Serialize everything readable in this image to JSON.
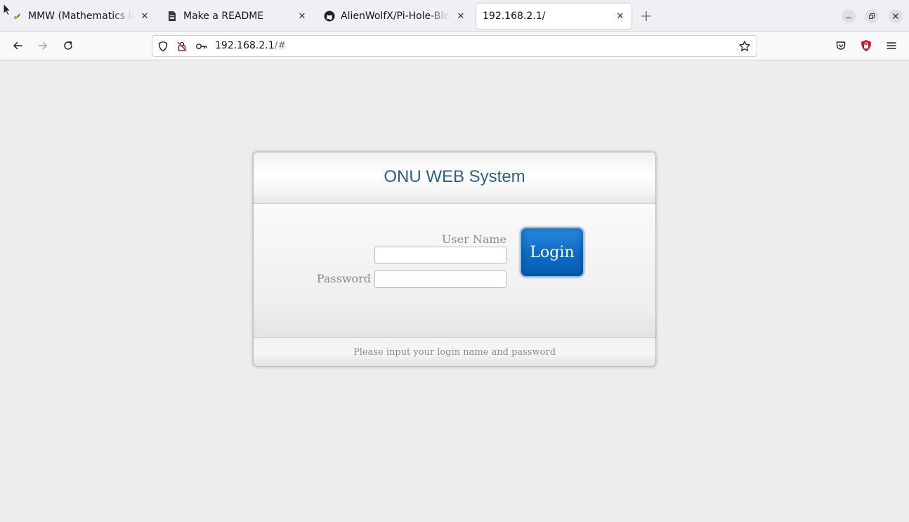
{
  "tabs": [
    {
      "label": "MMW (Mathematics in the Modern World)",
      "icon": "leaf-favicon-icon"
    },
    {
      "label": "Make a README",
      "icon": "document-icon"
    },
    {
      "label": "AlienWolfX/Pi-Hole-Blocklist",
      "icon": "github-icon"
    },
    {
      "label": "192.168.2.1/",
      "icon": "none",
      "active": true
    }
  ],
  "address": {
    "host": "192.168.2.1",
    "path": "/#"
  },
  "page": {
    "title": "ONU WEB System",
    "username_label": "User Name",
    "username_value": "",
    "password_label": "Password",
    "password_value": "",
    "login_label": "Login",
    "footer_hint": "Please input your login name and password"
  },
  "colors": {
    "title": "#2e6186",
    "login_button": "#0e6cc4",
    "page_background": "#ededed"
  }
}
